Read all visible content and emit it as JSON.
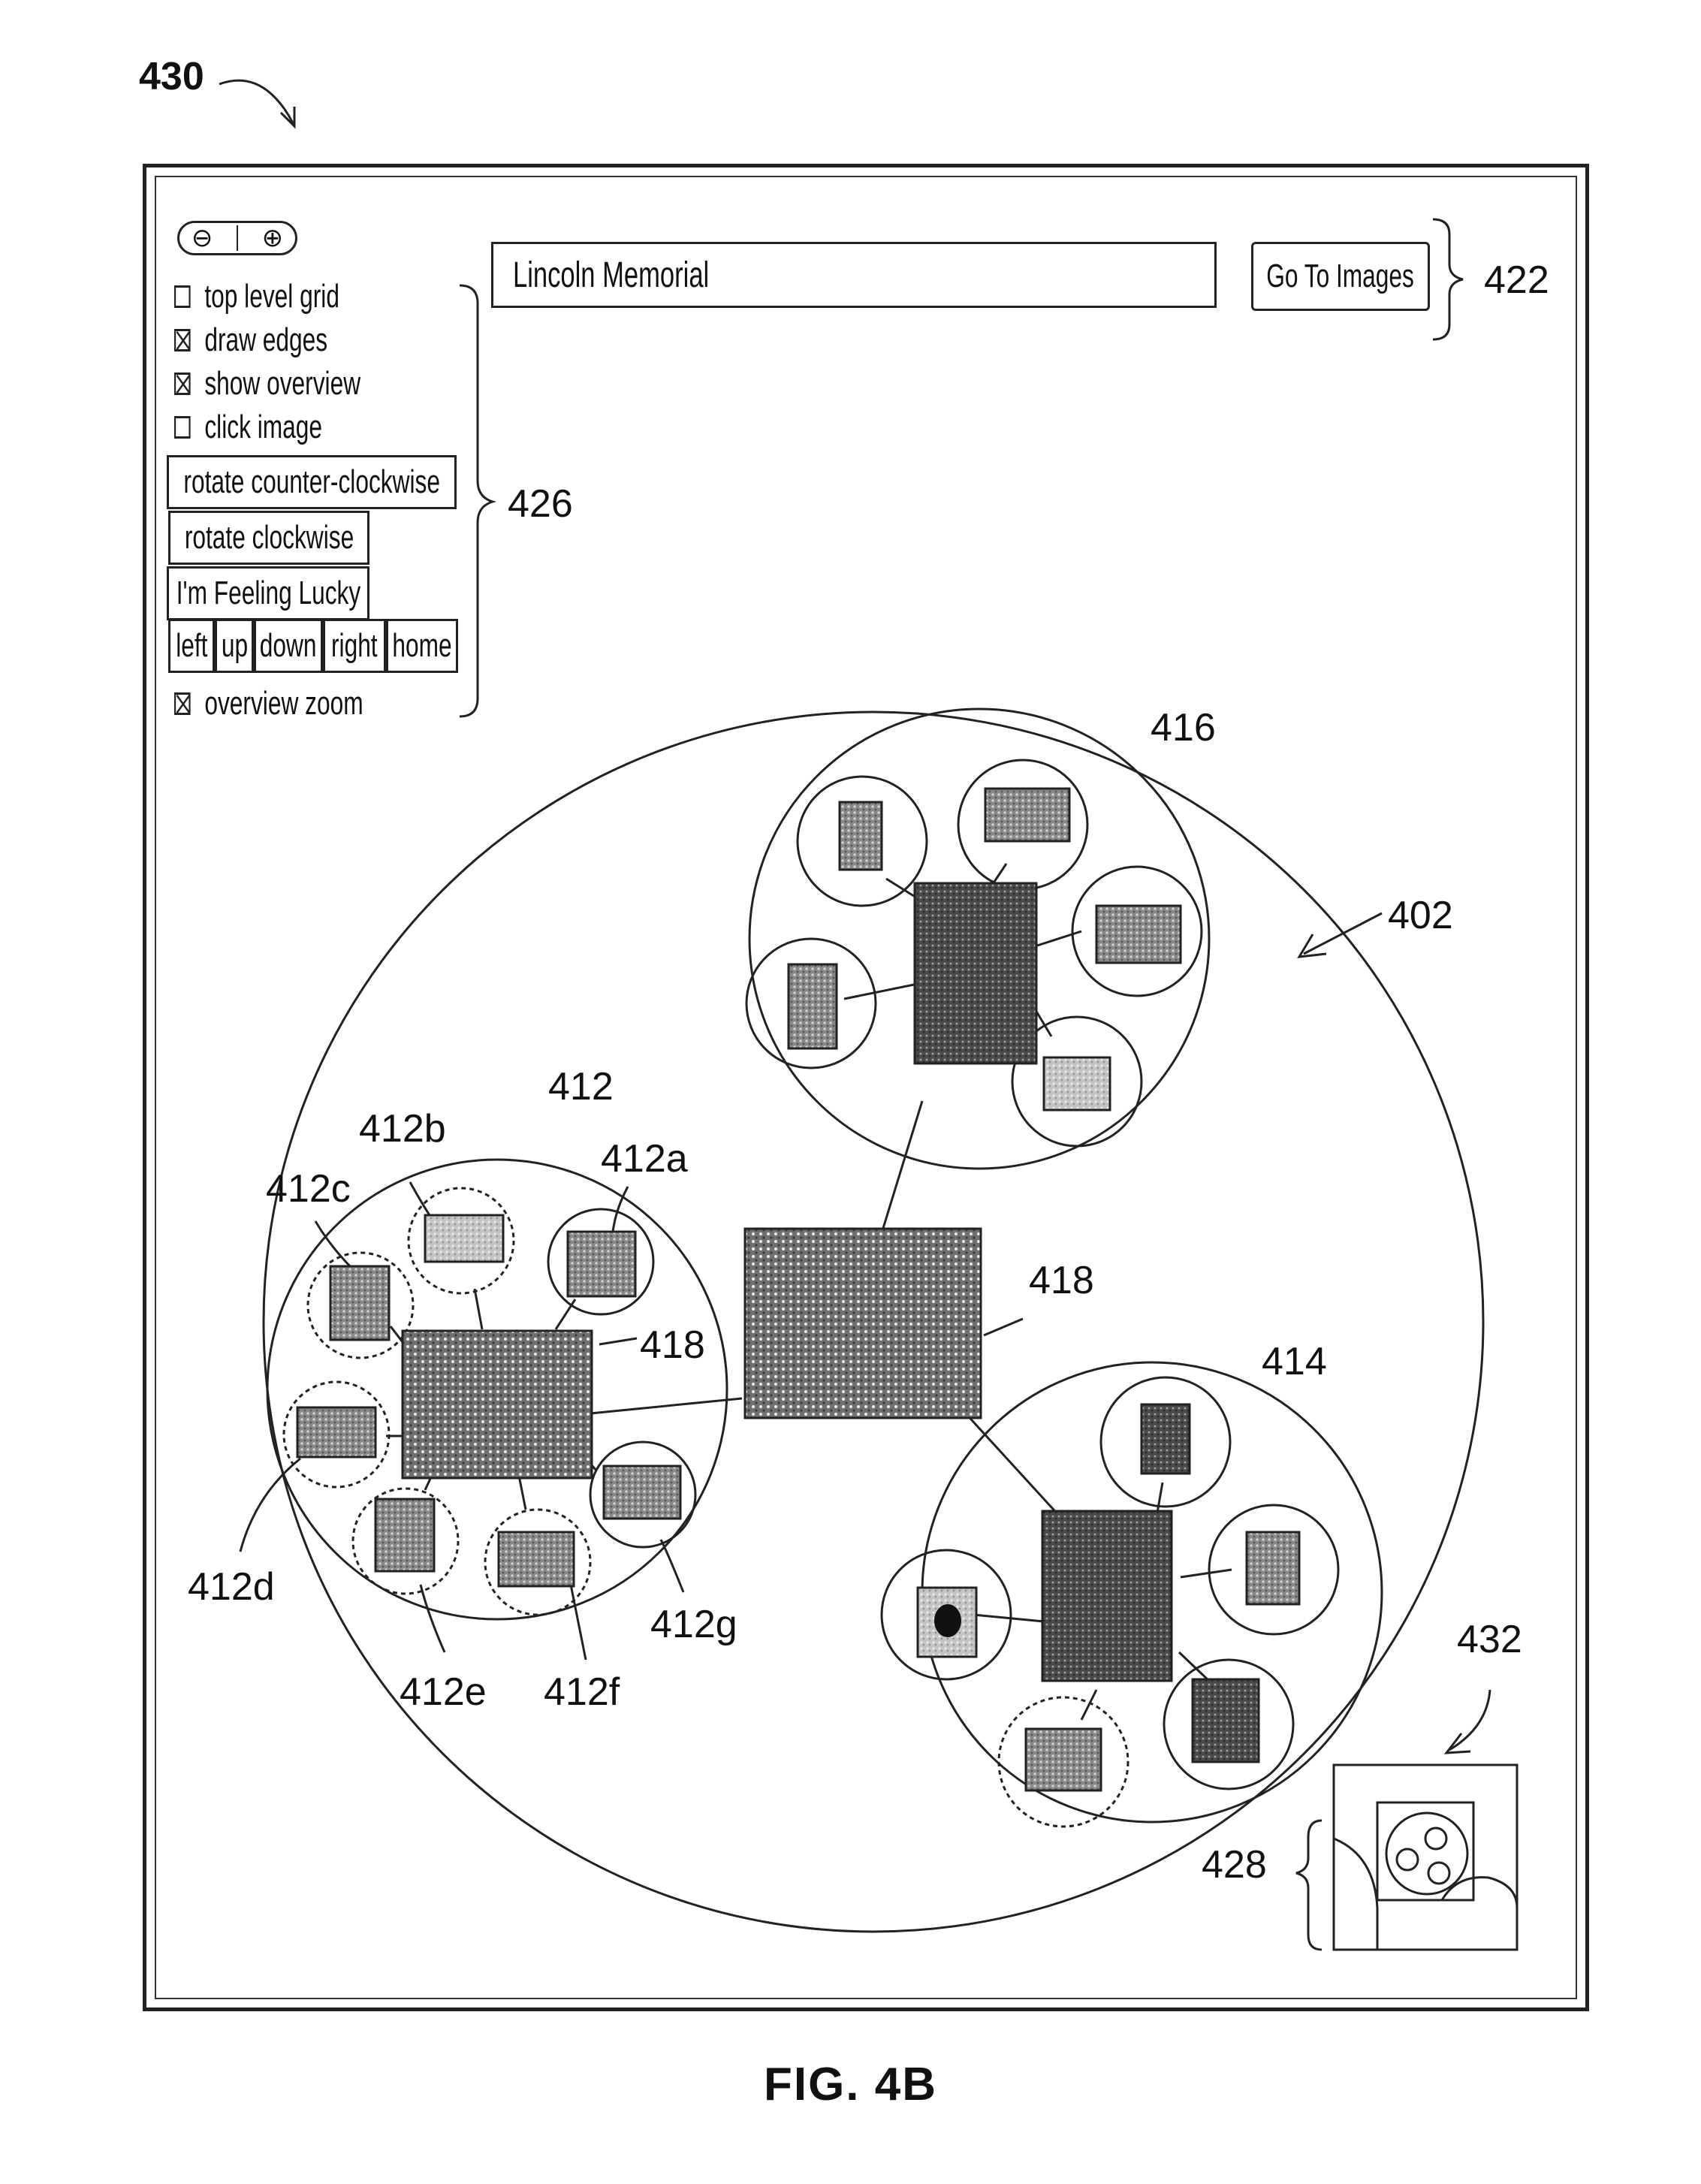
{
  "figure": {
    "number": "430",
    "caption": "FIG. 4B"
  },
  "controls": {
    "zoom_out_icon": "zoom-out-magnifier",
    "zoom_in_icon": "zoom-in-magnifier",
    "checkboxes": [
      {
        "label": "top level grid",
        "checked": false
      },
      {
        "label": "draw edges",
        "checked": true
      },
      {
        "label": "show overview",
        "checked": true
      },
      {
        "label": "click image",
        "checked": false
      }
    ],
    "rotate_ccw": "rotate counter-clockwise",
    "rotate_cw": "rotate clockwise",
    "lucky": "I'm Feeling Lucky",
    "nav": [
      "left",
      "up",
      "down",
      "right",
      "home"
    ],
    "overview_zoom": {
      "label": "overview zoom",
      "checked": true
    }
  },
  "search": {
    "value": "Lincoln Memorial",
    "button": "Go To Images"
  },
  "refs": {
    "r422": "422",
    "r426": "426",
    "r402": "402",
    "r416": "416",
    "r418_center": "418",
    "r418_left": "418",
    "r412": "412",
    "r412a": "412a",
    "r412b": "412b",
    "r412c": "412c",
    "r412d": "412d",
    "r412e": "412e",
    "r412f": "412f",
    "r412g": "412g",
    "r414": "414",
    "r432": "432",
    "r428": "428"
  }
}
